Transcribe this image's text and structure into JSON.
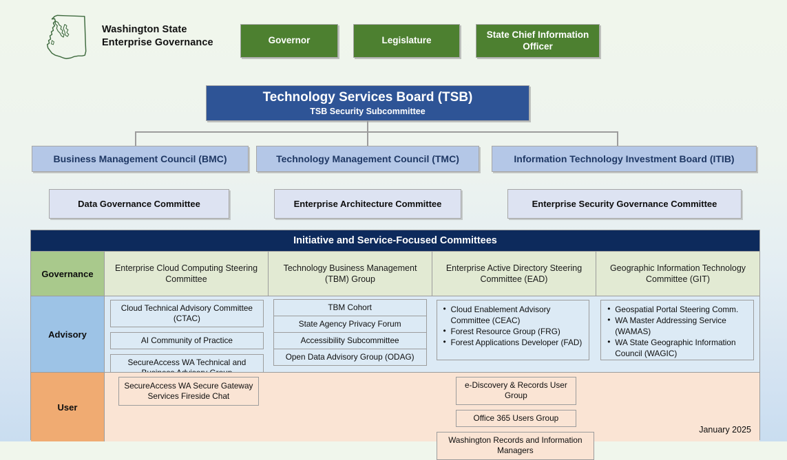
{
  "logo": {
    "icon": "washington-state-map-icon",
    "title_line1": "Washington State",
    "title_line2": "Enterprise Governance"
  },
  "top_boxes": [
    {
      "label": "Governor"
    },
    {
      "label": "Legislature"
    },
    {
      "label": "State Chief Information Officer"
    }
  ],
  "tsb": {
    "title": "Technology Services Board (TSB)",
    "subtitle": "TSB Security Subcommittee"
  },
  "councils": [
    {
      "label": "Business Management Council (BMC)"
    },
    {
      "label": "Technology Management Council (TMC)"
    },
    {
      "label": "Information Technology Investment Board (ITIB)"
    }
  ],
  "subcommittees": [
    {
      "label": "Data Governance Committee"
    },
    {
      "label": "Enterprise Architecture Committee"
    },
    {
      "label": "Enterprise Security Governance Committee"
    }
  ],
  "matrix": {
    "header": "Initiative and Service-Focused Committees",
    "rows": {
      "governance": {
        "label": "Governance",
        "cells": [
          "Enterprise Cloud Computing Steering Committee",
          "Technology Business Management (TBM) Group",
          "Enterprise Active Directory Steering Committee (EAD)",
          "Geographic Information Technology Committee (GIT)"
        ]
      },
      "advisory": {
        "label": "Advisory",
        "col1": [
          "Cloud Technical Advisory Committee (CTAC)",
          "AI Community of Practice",
          "SecureAccess WA Technical and Business Advisory Group"
        ],
        "col2": [
          "TBM Cohort",
          "State Agency Privacy Forum",
          "Accessibility Subcommittee",
          "Open Data Advisory Group (ODAG)"
        ],
        "col3": [
          "Cloud Enablement Advisory Committee (CEAC)",
          "Forest Resource Group (FRG)",
          "Forest Applications Developer (FAD)"
        ],
        "col4": [
          "Geospatial Portal Steering Comm.",
          "WA Master Addressing Service (WAMAS)",
          "WA State Geographic Information Council (WAGIC)"
        ]
      },
      "user": {
        "label": "User",
        "col1": [
          "SecureAccess WA Secure Gateway Services Fireside Chat"
        ],
        "col3": [
          "e-Discovery & Records User Group",
          "Office 365 Users Group"
        ],
        "wide": "Washington Records and Information Managers"
      }
    }
  },
  "footer": {
    "date": "January 2025"
  },
  "colors": {
    "green": "#4d8030",
    "tsb_blue": "#2e5496",
    "council_blue": "#b4c7e7",
    "subcom_blue": "#dde3f2",
    "header_navy": "#0d2a5c",
    "governance_green": "#a9c98c",
    "advisory_blue": "#9dc3e6",
    "user_orange": "#f0ab72"
  }
}
